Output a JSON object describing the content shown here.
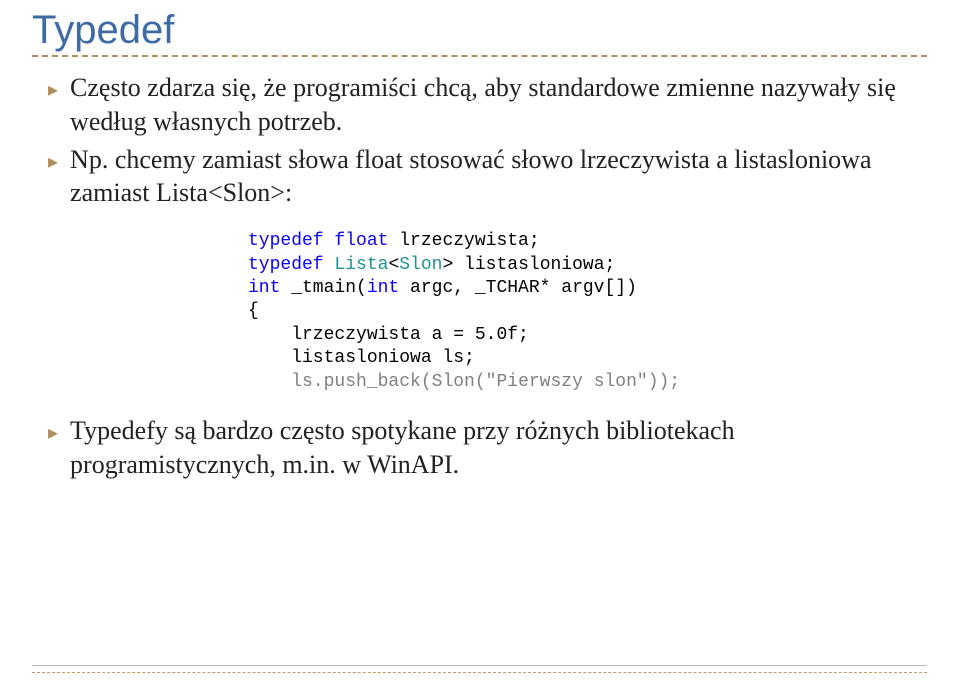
{
  "title": "Typedef",
  "bullets": [
    {
      "marker": "▸",
      "text": "Często zdarza się, że programiści chcą, aby standardowe zmienne nazywały się według własnych potrzeb."
    },
    {
      "marker": "▸",
      "text": "Np. chcemy zamiast słowa float stosować słowo lrzeczywista a listasloniowa zamiast Lista<Slon>:"
    },
    {
      "marker": "▸",
      "text": "Typedefy są bardzo często spotykane przy różnych bibliotekach programistycznych, m.in. w WinAPI."
    }
  ],
  "code": {
    "l1": {
      "kw1": "typedef ",
      "kw2": "float",
      "rest": " lrzeczywista;"
    },
    "l2": {
      "kw1": "typedef ",
      "type1": "Lista",
      "delim1": "<",
      "type2": "Slon",
      "delim2": ">",
      "rest": " listasloniowa;"
    },
    "l3": "",
    "l4": "",
    "l5": {
      "kw1": "int",
      "rest": " _tmain(",
      "kw2": "int",
      "rest2": " argc, _TCHAR* argv[])"
    },
    "l6": "{",
    "l7": "    lrzeczywista a = 5.0f;",
    "l8": "    listasloniowa ls;",
    "l9": "",
    "l10a": "    ls.push_back(",
    "l10type": "Slon",
    "l10b": "(",
    "l10str": "\"Pierwszy slon\"",
    "l10c": "));"
  }
}
